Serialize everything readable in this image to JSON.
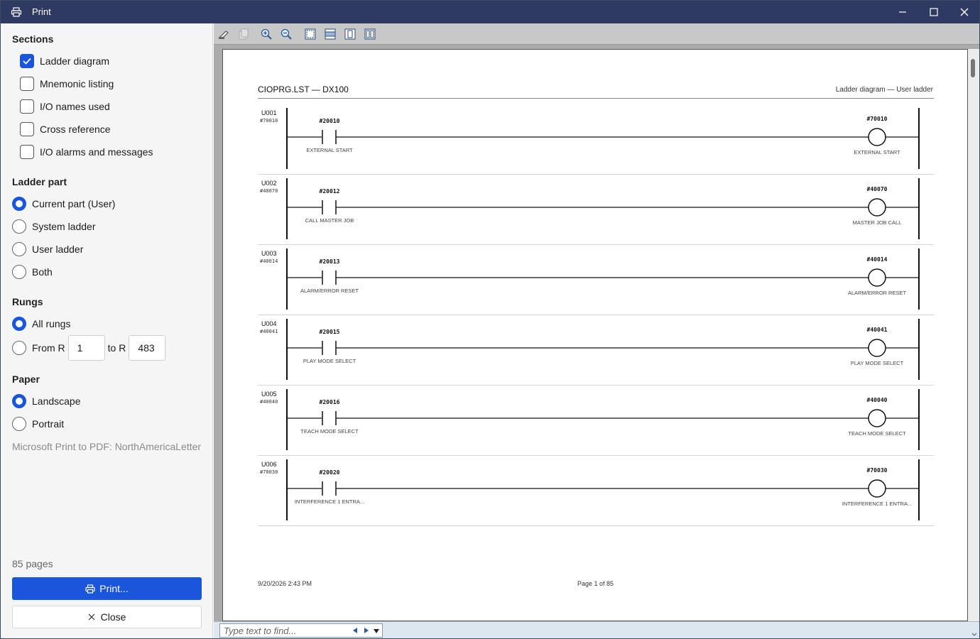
{
  "window": {
    "title": "Print"
  },
  "sidebar": {
    "sections_title": "Sections",
    "sections": [
      {
        "label": "Ladder diagram",
        "checked": true
      },
      {
        "label": "Mnemonic listing",
        "checked": false
      },
      {
        "label": "I/O names used",
        "checked": false
      },
      {
        "label": "Cross reference",
        "checked": false
      },
      {
        "label": "I/O alarms and messages",
        "checked": false
      }
    ],
    "ladder_part_title": "Ladder part",
    "ladder_parts": [
      {
        "label": "Current part (User)",
        "selected": true
      },
      {
        "label": "System ladder",
        "selected": false
      },
      {
        "label": "User ladder",
        "selected": false
      },
      {
        "label": "Both",
        "selected": false
      }
    ],
    "rungs_title": "Rungs",
    "rungs_all": {
      "label": "All rungs",
      "selected": true
    },
    "rungs_range": {
      "from_label": "From R",
      "from_value": "1",
      "to_label": "to R",
      "to_value": "483",
      "selected": false
    },
    "paper_title": "Paper",
    "paper": [
      {
        "label": "Landscape",
        "selected": true
      },
      {
        "label": "Portrait",
        "selected": false
      }
    ],
    "printer_info": "Microsoft Print to PDF: NorthAmericaLetter",
    "page_count": "85 pages",
    "print_label": "Print...",
    "close_label": "Close"
  },
  "preview": {
    "doc_title": "CIOPRG.LST — DX100",
    "doc_subtitle": "Ladder diagram — User ladder",
    "rungs": [
      {
        "id": "U001",
        "addr": "#70010",
        "contact_addr": "#20010",
        "contact_name": "EXTERNAL START",
        "output_addr": "#70010",
        "output_name": "EXTERNAL START"
      },
      {
        "id": "U002",
        "addr": "#40070",
        "contact_addr": "#20012",
        "contact_name": "CALL MASTER JOB",
        "output_addr": "#40070",
        "output_name": "MASTER JOB CALL"
      },
      {
        "id": "U003",
        "addr": "#40014",
        "contact_addr": "#20013",
        "contact_name": "ALARM/ERROR RESET",
        "output_addr": "#40014",
        "output_name": "ALARM/ERROR RESET"
      },
      {
        "id": "U004",
        "addr": "#40041",
        "contact_addr": "#20015",
        "contact_name": "PLAY MODE SELECT",
        "output_addr": "#40041",
        "output_name": "PLAY MODE SELECT"
      },
      {
        "id": "U005",
        "addr": "#40040",
        "contact_addr": "#20016",
        "contact_name": "TEACH MODE SELECT",
        "output_addr": "#40040",
        "output_name": "TEACH MODE SELECT"
      },
      {
        "id": "U006",
        "addr": "#70030",
        "contact_addr": "#20020",
        "contact_name": "INTERFERENCE 1 ENTRA...",
        "output_addr": "#70030",
        "output_name": "INTERFERENCE 1 ENTRA..."
      }
    ],
    "footer_date": "9/20/2026 2:43 PM",
    "footer_page": "Page 1 of 85",
    "find_placeholder": "Type text to find..."
  },
  "colors": {
    "accent": "#1a56db",
    "titlebar": "#2f3a63",
    "preview_bg": "#ababab"
  }
}
